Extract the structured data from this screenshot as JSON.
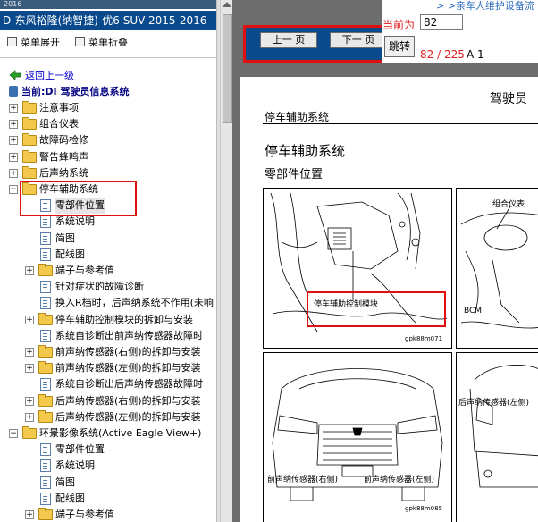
{
  "left": {
    "strip": "2016",
    "title": "D-东风裕隆(纳智捷)-优6 SUV-2015-2016-",
    "menu_expand": "菜单展开",
    "menu_collapse": "菜单折叠",
    "back": "返回上一级",
    "current": "当前:DI 驾驶员信息系统",
    "tree": [
      {
        "label": "注意事项",
        "type": "folder",
        "level": 0
      },
      {
        "label": "组合仪表",
        "type": "folder",
        "level": 0
      },
      {
        "label": "故障码检修",
        "type": "folder",
        "level": 0
      },
      {
        "label": "警告蜂鸣声",
        "type": "folder",
        "level": 0
      },
      {
        "label": "后声纳系统",
        "type": "folder",
        "level": 0
      },
      {
        "label": "停车辅助系统",
        "type": "folder",
        "level": 0,
        "open": true
      },
      {
        "label": "零部件位置",
        "type": "page",
        "level": 1,
        "selected": true
      },
      {
        "label": "系统说明",
        "type": "page",
        "level": 1
      },
      {
        "label": "简图",
        "type": "page",
        "level": 1
      },
      {
        "label": "配线图",
        "type": "page",
        "level": 1
      },
      {
        "label": "端子与参考值",
        "type": "folder",
        "level": 1
      },
      {
        "label": "针对症状的故障诊断",
        "type": "page",
        "level": 1
      },
      {
        "label": "换入R档时，后声纳系统不作用(未响",
        "type": "page",
        "level": 1
      },
      {
        "label": "停车辅助控制模块的拆卸与安装",
        "type": "folder",
        "level": 1
      },
      {
        "label": "系统自诊断出前声纳传感器故障时",
        "type": "page",
        "level": 1
      },
      {
        "label": "前声纳传感器(右侧)的拆卸与安装",
        "type": "folder",
        "level": 1
      },
      {
        "label": "前声纳传感器(左侧)的拆卸与安装",
        "type": "folder",
        "level": 1
      },
      {
        "label": "系统自诊断出后声纳传感器故障时",
        "type": "page",
        "level": 1
      },
      {
        "label": "后声纳传感器(右侧)的拆卸与安装",
        "type": "folder",
        "level": 1
      },
      {
        "label": "后声纳传感器(左侧)的拆卸与安装",
        "type": "folder",
        "level": 1
      },
      {
        "label": "环景影像系统(Active Eagle View+)",
        "type": "folder",
        "level": 0,
        "open": true
      },
      {
        "label": "零部件位置",
        "type": "page",
        "level": 1
      },
      {
        "label": "系统说明",
        "type": "page",
        "level": 1
      },
      {
        "label": "简图",
        "type": "page",
        "level": 1
      },
      {
        "label": "配线图",
        "type": "page",
        "level": 1
      },
      {
        "label": "端子与参考值",
        "type": "folder",
        "level": 1
      }
    ]
  },
  "right": {
    "top_text": "> >亲车人维护设备流",
    "prev": "上一 页",
    "next": "下一 页",
    "current_label": "当前为",
    "page_value": "82",
    "go": "跳转",
    "page_count": "82 / 225",
    "page_suffix": "A 1"
  },
  "doc": {
    "header": "驾驶员",
    "section": "停车辅助系统",
    "title": "停车辅助系统",
    "subtitle": "零部件位置",
    "fig1_label": "停车辅助控制模块",
    "fig1_code": "gpk88m071",
    "fig2_label_a": "组合仪表",
    "fig2_label_b": "BCM",
    "fig3_label_a": "前声纳传感器(右侧)",
    "fig3_label_b": "前声纳传感器(左侧)",
    "fig3_code": "gpk88m085",
    "fig4_label": "后声纳传感器(左侧)"
  },
  "colors": {
    "title_bar": "#0a4a8c",
    "highlight": "#e01010",
    "link": "#0000cc",
    "page_count": "#e02020"
  }
}
